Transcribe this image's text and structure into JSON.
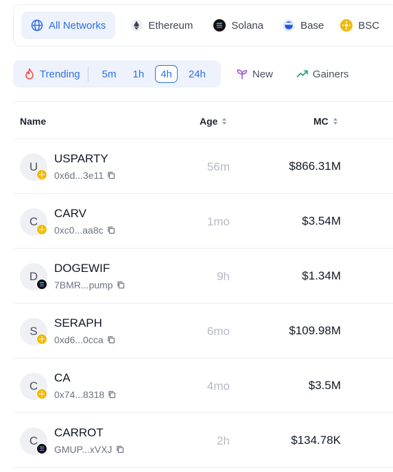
{
  "networks": [
    {
      "label": "All Networks",
      "icon": "globe-icon"
    },
    {
      "label": "Ethereum",
      "icon": "ethereum-icon"
    },
    {
      "label": "Solana",
      "icon": "solana-icon"
    },
    {
      "label": "Base",
      "icon": "base-icon"
    },
    {
      "label": "BSC",
      "icon": "bsc-icon"
    }
  ],
  "filters": {
    "trending_label": "Trending",
    "timeframes": [
      "5m",
      "1h",
      "4h",
      "24h"
    ],
    "active_timeframe": "4h",
    "new_label": "New",
    "gainers_label": "Gainers"
  },
  "table": {
    "headers": {
      "name": "Name",
      "age": "Age",
      "mc": "MC"
    },
    "rows": [
      {
        "initial": "U",
        "name": "USPARTY",
        "address": "0x6d...3e11",
        "chain": "bsc",
        "age": "56m",
        "mc": "$866.31M"
      },
      {
        "initial": "C",
        "name": "CARV",
        "address": "0xc0...aa8c",
        "chain": "bsc",
        "age": "1mo",
        "mc": "$3.54M"
      },
      {
        "initial": "D",
        "name": "DOGEWIF",
        "address": "7BMR...pump",
        "chain": "solana",
        "age": "9h",
        "mc": "$1.34M"
      },
      {
        "initial": "S",
        "name": "SERAPH",
        "address": "0xd6...0cca",
        "chain": "bsc",
        "age": "6mo",
        "mc": "$109.98M"
      },
      {
        "initial": "C",
        "name": "CA",
        "address": "0x74...8318",
        "chain": "bsc",
        "age": "4mo",
        "mc": "$3.5M"
      },
      {
        "initial": "C",
        "name": "CARROT",
        "address": "GMUP...xVXJ",
        "chain": "solana",
        "age": "2h",
        "mc": "$134.78K"
      }
    ]
  },
  "colors": {
    "accent": "#2f6fe4",
    "accent_bg": "#edf2fc",
    "bsc": "#f0b90b",
    "gainers": "#16a36a",
    "new": "#9b59d0"
  }
}
